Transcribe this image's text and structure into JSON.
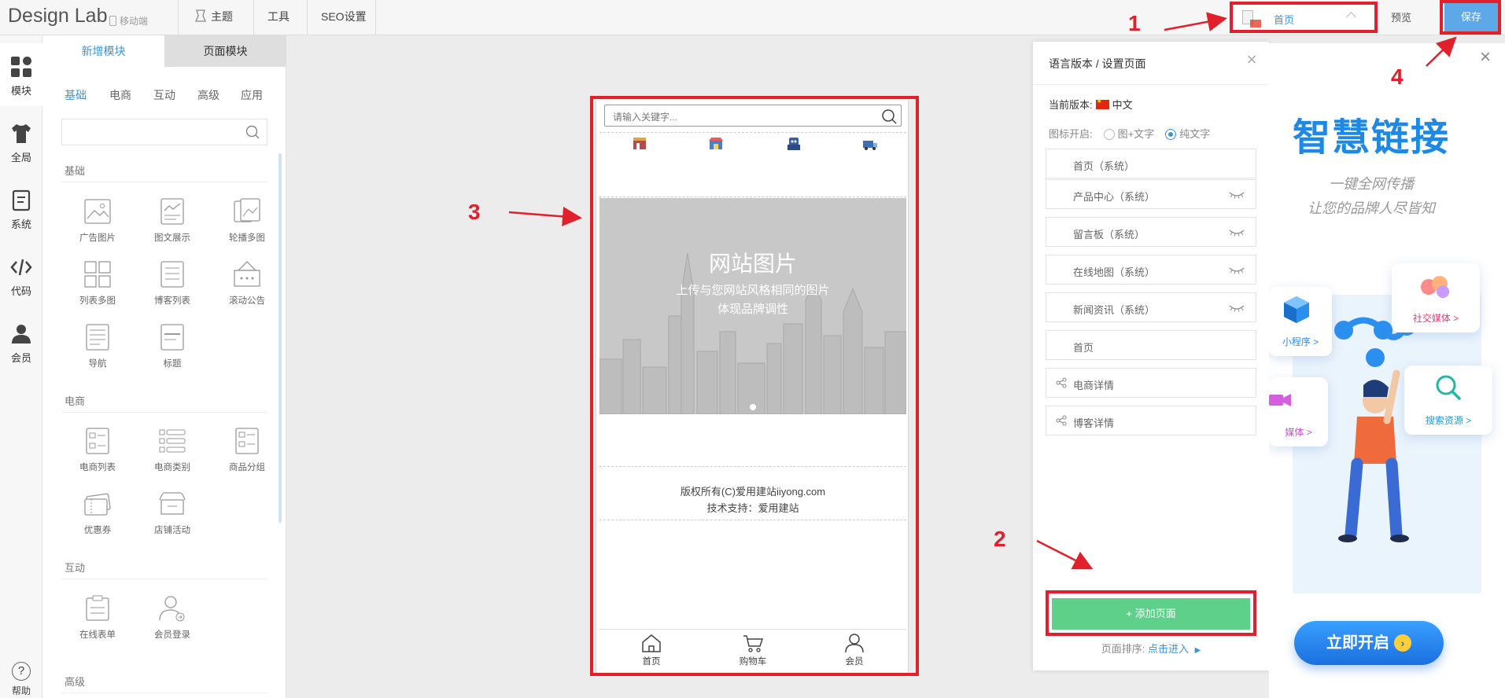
{
  "topbar": {
    "brand": "Design Lab",
    "mobile": "移动端",
    "tabs": [
      "主题",
      "工具",
      "SEO设置"
    ],
    "page_select": "首页",
    "preview": "预览",
    "save": "保存"
  },
  "rail": {
    "items": [
      "模块",
      "全局",
      "系统",
      "代码",
      "会员"
    ],
    "help": "帮助"
  },
  "panel": {
    "tabs": [
      "新增模块",
      "页面模块"
    ],
    "categories": [
      "基础",
      "电商",
      "互动",
      "高级",
      "应用"
    ],
    "sections": {
      "basic": "基础",
      "ecom": "电商",
      "interact": "互动",
      "advanced": "高级"
    },
    "basic_modules": [
      "广告图片",
      "图文展示",
      "轮播多图",
      "列表多图",
      "博客列表",
      "滚动公告",
      "导航",
      "标题"
    ],
    "ecom_modules": [
      "电商列表",
      "电商类别",
      "商品分组",
      "优惠券",
      "店铺活动"
    ],
    "interact_modules": [
      "在线表单",
      "会员登录"
    ]
  },
  "phone": {
    "search_placeholder": "请输入关键字...",
    "banner_title": "网站图片",
    "banner_sub1": "上传与您网站风格相同的图片",
    "banner_sub2": "体现品牌调性",
    "copyright": "版权所有(C)爱用建站iiyong.com",
    "support": "技术支持：爱用建站",
    "tabbar": [
      "首页",
      "购物车",
      "会员"
    ]
  },
  "dialog": {
    "title": "语言版本 / 设置页面",
    "version_label": "当前版本:",
    "version_value": "中文",
    "icon_mode_label": "图标开启:",
    "icon_mode_opt1": "图+文字",
    "icon_mode_opt2": "纯文字",
    "pages": [
      "首页（系统）",
      "产品中心（系统）",
      "留言板（系统）",
      "在线地图（系统）",
      "新闻资讯（系统）",
      "首页",
      "电商详情",
      "博客详情"
    ],
    "add_page": "+ 添加页面",
    "sort_label": "页面排序:",
    "sort_link": "点击进入"
  },
  "promo": {
    "title": "智慧链接",
    "sub1": "一键全网传播",
    "sub2": "让您的品牌人尽皆知",
    "cards": [
      "社交媒体 >",
      "小程序 >",
      "媒体 >",
      "搜索资源 >"
    ],
    "cta": "立即开启"
  },
  "annotations": [
    "1",
    "2",
    "3",
    "4"
  ],
  "colors": {
    "accent": "#3b95d8",
    "annotation": "#e0202a",
    "add_button": "#5fd08a"
  }
}
